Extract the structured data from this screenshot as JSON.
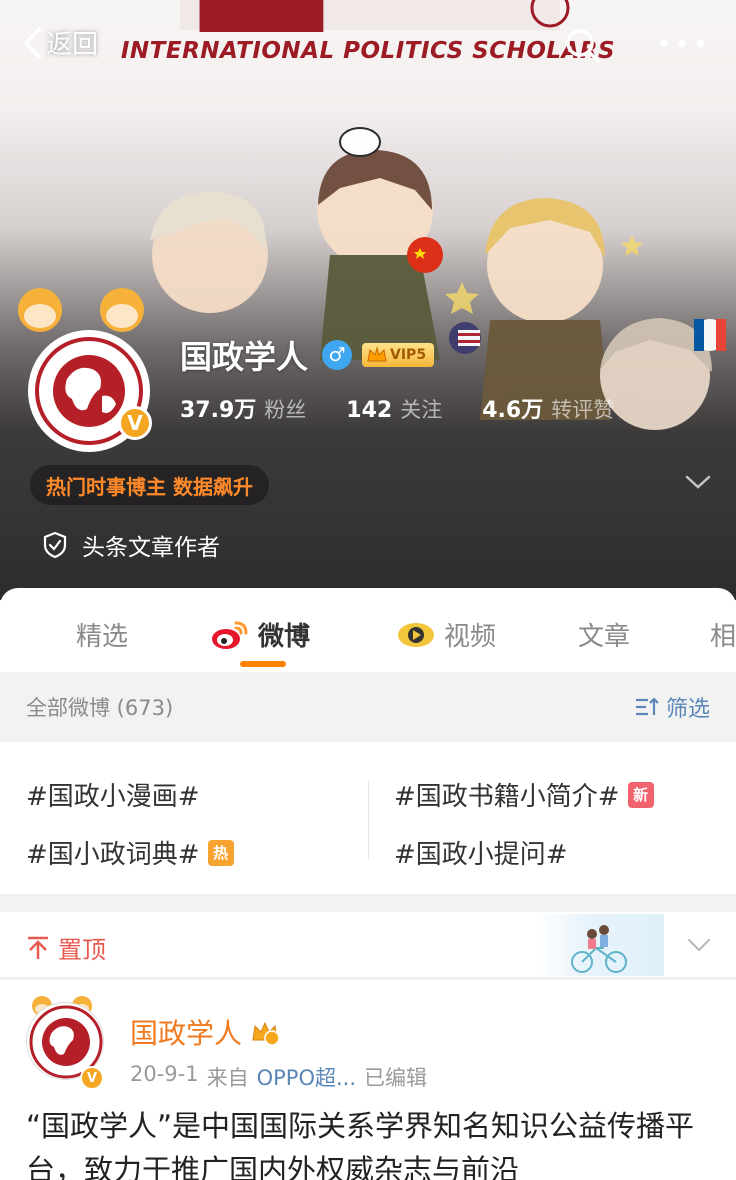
{
  "topbar": {
    "back_label": "返回",
    "banner_text": "INTERNATIONAL POLITICS SCHOLARS"
  },
  "profile": {
    "name": "国政学人",
    "gender_symbol": "♂",
    "vip_label": "VIP5",
    "verified_symbol": "V",
    "stats": [
      {
        "value": "37.9万",
        "label": "粉丝"
      },
      {
        "value": "142",
        "label": "关注"
      },
      {
        "value": "4.6万",
        "label": "转评赞"
      }
    ],
    "hot_tag": "热门时事博主 数据飙升",
    "author_label": "头条文章作者"
  },
  "tabs": [
    {
      "label": "精选",
      "active": false
    },
    {
      "label": "微博",
      "active": true
    },
    {
      "label": "视频",
      "active": false
    },
    {
      "label": "文章",
      "active": false
    },
    {
      "label": "相",
      "active": false
    }
  ],
  "filter": {
    "count_label": "全部微博 (673)",
    "filter_label": "筛选"
  },
  "topics": [
    {
      "label": "#国政小漫画#",
      "badge": ""
    },
    {
      "label": "#国政书籍小简介#",
      "badge": "新"
    },
    {
      "label": "#国小政词典#",
      "badge": "热"
    },
    {
      "label": "#国政小提问#",
      "badge": ""
    }
  ],
  "pinned": {
    "label": "置顶"
  },
  "post": {
    "author": "国政学人",
    "date": "20-9-1",
    "source_prefix": "来自",
    "source": "OPPO超...",
    "edited": "已编辑",
    "text": "“国政学人”是中国国际关系学界知名知识公益传播平台，致力于推广国内外权威杂志与前沿"
  },
  "colors": {
    "accent": "#ff8200",
    "link": "#5b86b8",
    "hot": "#ff8a2a",
    "pinned": "#e85a4f",
    "brand_red": "#9d1b24"
  }
}
